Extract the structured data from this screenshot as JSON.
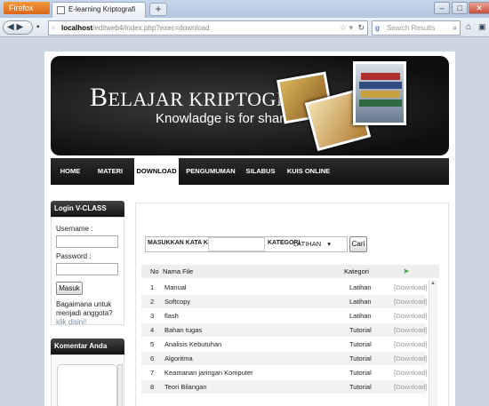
{
  "browser": {
    "firefox_label": "Firefox",
    "tab_title": "E-learning Kriptografi",
    "new_tab": "+",
    "url_host": "localhost",
    "url_path": "/editweb4/index.php?exec=download",
    "search_placeholder": "Search Results"
  },
  "banner": {
    "title_big_b": "B",
    "title_rest": "ELAJAR KRIPTOGRAFI",
    "tagline": "Knowladge is for share"
  },
  "menu": [
    {
      "label": "HOME"
    },
    {
      "label": "MATERI"
    },
    {
      "label": "DOWNLOAD"
    },
    {
      "label": "PENGUMUMAN"
    },
    {
      "label": "SILABUS"
    },
    {
      "label": "KUIS ONLINE"
    }
  ],
  "login": {
    "heading": "Login V-CLASS",
    "username_label": "Username :",
    "password_label": "Password :",
    "button": "Masuk",
    "help_text": "Bagaimana untuk menjadi anggota?",
    "help_link": "klik disini!"
  },
  "comments": {
    "heading": "Komentar Anda"
  },
  "search": {
    "keyword_label": "MASUKKAN KATA KUNCI :",
    "category_label": "KATEGORI",
    "category_value": "LATIHAN",
    "button": "Cari"
  },
  "table": {
    "headers": {
      "no": "No",
      "name": "Nama File",
      "category": "Kategori"
    },
    "rows": [
      {
        "no": "1",
        "name": "Manual",
        "category": "Latihan",
        "action": "[Download]"
      },
      {
        "no": "2",
        "name": "Softcopy",
        "category": "Latihan",
        "action": "[Download]"
      },
      {
        "no": "3",
        "name": "flash",
        "category": "Latihan",
        "action": "[Download]"
      },
      {
        "no": "4",
        "name": "Bahan tugas",
        "category": "Tutorial",
        "action": "[Download]"
      },
      {
        "no": "5",
        "name": "Analisis Kebutuhan",
        "category": "Tutorial",
        "action": "[Download]"
      },
      {
        "no": "6",
        "name": "Algoritma",
        "category": "Tutorial",
        "action": "[Download]"
      },
      {
        "no": "7",
        "name": "Keamanan jaringan Komputer",
        "category": "Tutorial",
        "action": "[Download]"
      },
      {
        "no": "8",
        "name": "Teori Bilangan",
        "category": "Tutorial",
        "action": "[Download]"
      }
    ]
  },
  "colors": {
    "banner_bg": "#111111",
    "menu_bg": "#1a1a1a",
    "accent_green": "#3da53d"
  }
}
